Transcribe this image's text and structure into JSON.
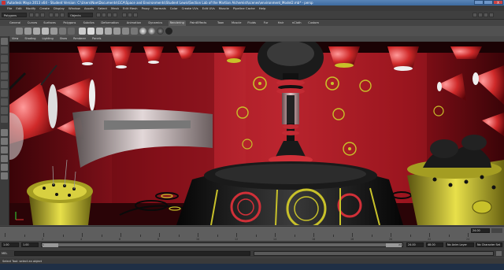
{
  "window": {
    "title": "Autodesk Maya 2013 x64 - Student Version: C:\\Users\\Noe\\Documents\\GCA\\Space and Environments\\Student Lewis\\Section Lab of the Martian Alchemist\\scenes\\environment_Model2.mb* - persp",
    "minimize_label": "",
    "maximize_label": "",
    "close_label": "X"
  },
  "menubar": {
    "items": [
      "File",
      "Edit",
      "Modify",
      "Create",
      "Display",
      "Window",
      "Assets",
      "Select",
      "Mesh",
      "Edit Mesh",
      "Proxy",
      "Normals",
      "Color",
      "Create UVs",
      "Edit UVs",
      "Muscle",
      "Pipeline Cache",
      "Help"
    ]
  },
  "statusline": {
    "menuset": "Polygons",
    "selection_field": "Objects"
  },
  "shelf": {
    "tabs": [
      "General",
      "Curves",
      "Surfaces",
      "Polygons",
      "Subdivs",
      "Deformation",
      "Animation",
      "Dynamics",
      "Rendering",
      "PaintEffects",
      "Toon",
      "Muscle",
      "Fluids",
      "Fur",
      "Hair",
      "nCloth",
      "Custom"
    ],
    "active_tab": "Rendering"
  },
  "panel_menu": {
    "items": [
      "View",
      "Shading",
      "Lighting",
      "Show",
      "Renderer",
      "Panels"
    ]
  },
  "timeslider": {
    "ticks": [
      "2",
      "4",
      "6",
      "8",
      "10",
      "12",
      "14",
      "16",
      "18",
      "20",
      "22",
      "24"
    ],
    "current_frame": "24.00"
  },
  "range": {
    "start_time": "1.00",
    "playback_start": "1.00",
    "range_label": "1",
    "range_end_label": "24",
    "playback_end": "24.00",
    "end_time": "48.00",
    "anim_layer": "No Anim Layer",
    "char_set": "No Character Set"
  },
  "commandline": {
    "mode": "MEL",
    "input": ""
  },
  "helpline": {
    "text": "Select Tool: select an object"
  },
  "colors": {
    "maya_bg": "#444444",
    "title_blue": "#3d6a9e",
    "scene_red": "#8b0e18",
    "scene_yellow": "#c8c12a"
  }
}
